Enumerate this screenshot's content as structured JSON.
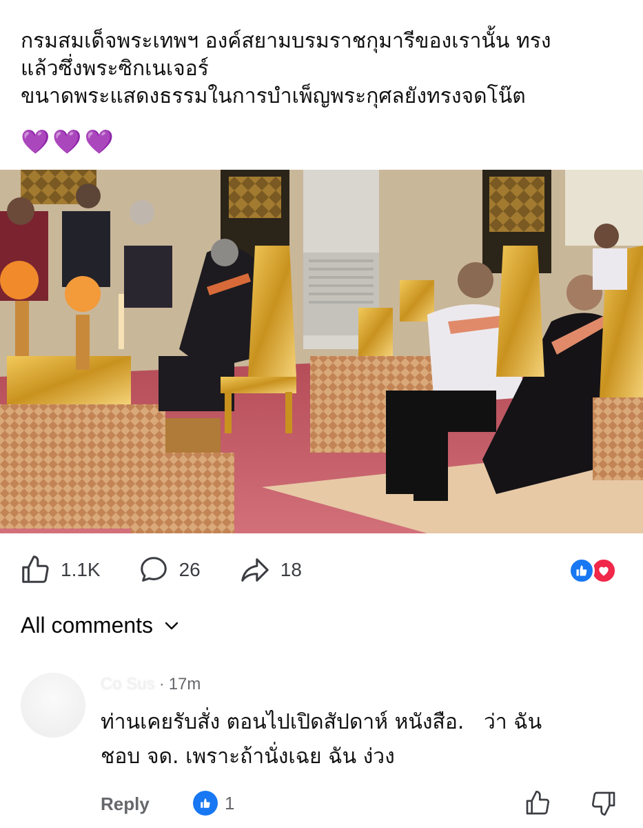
{
  "post": {
    "text_lines": [
      "กรมสมเด็จพระเทพฯ องค์สยามบรมราชกุมารีของเรานั้น ทรง",
      "แล้วซึ่งพระซิกเนเจอร์",
      "ขนาดพระแสดงธรรมในการบำเพ็ญพระกุศลยังทรงจดโน๊ต"
    ],
    "hearts": [
      "💜",
      "💜",
      "💜"
    ]
  },
  "actions": {
    "likes": "1.1K",
    "comments": "26",
    "shares": "18",
    "reaction_icons": [
      "like-icon",
      "love-icon"
    ]
  },
  "comments_section": {
    "label": "All comments"
  },
  "comment": {
    "author": "Co Sus",
    "separator": "·",
    "time": "17m",
    "body_lines": [
      "ท่านเคยรับสั่ง ตอนไปเปิดสัปดาห์ หนังสือ.   ว่า ฉัน",
      "ชอบ จด. เพราะถ้านั่งเฉย ฉัน ง่วง"
    ],
    "reply_label": "Reply",
    "like_count": "1"
  },
  "colors": {
    "facebook_blue": "#1877f2",
    "love_red": "#f02849",
    "heart_purple": "#a855f7",
    "secondary_text": "#65676b"
  }
}
